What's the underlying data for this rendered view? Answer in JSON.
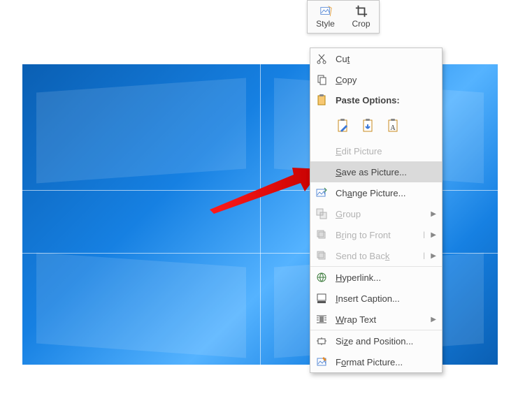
{
  "mini_toolbar": {
    "style": "Style",
    "crop": "Crop"
  },
  "context_menu": {
    "cut": "Cut",
    "copy": "Copy",
    "paste_options": "Paste Options:",
    "edit_picture": "Edit Picture",
    "save_as_picture": "Save as Picture...",
    "change_picture": "Change Picture...",
    "group": "Group",
    "bring_to_front": "Bring to Front",
    "send_to_back": "Send to Back",
    "hyperlink": "Hyperlink...",
    "insert_caption": "Insert Caption...",
    "wrap_text": "Wrap Text",
    "size_and_position": "Size and Position...",
    "format_picture": "Format Picture..."
  }
}
